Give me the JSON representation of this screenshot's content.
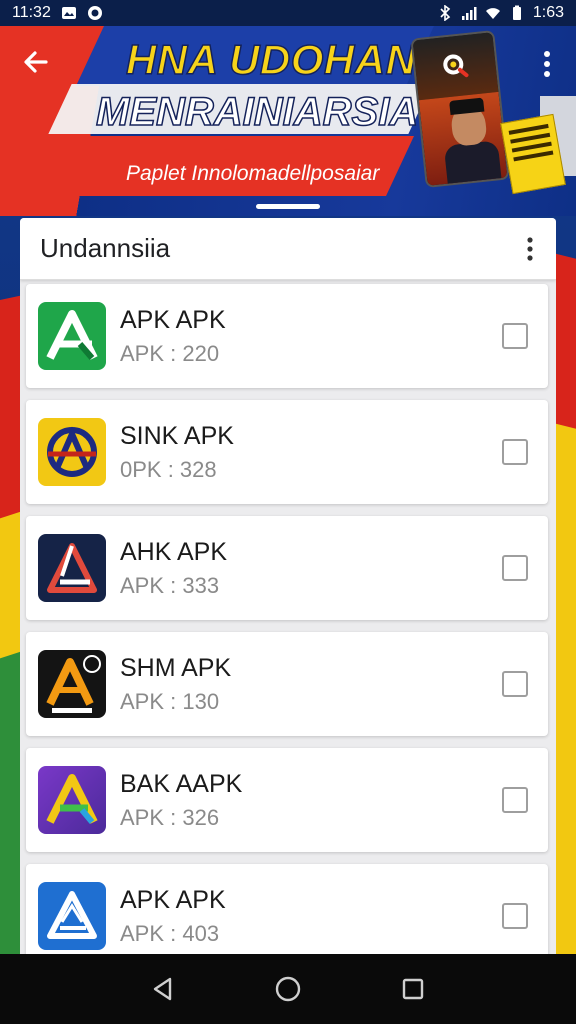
{
  "status_bar": {
    "time": "11:32",
    "right_time": "1:63",
    "icons": [
      "gallery-icon",
      "app-notification-icon",
      "bluetooth-icon",
      "signal-icon",
      "wifi-icon",
      "battery-icon"
    ]
  },
  "banner": {
    "title_line1": "HNA UDOHAN",
    "title_line2": "MENRAINIARSIA",
    "subtitle": "Paplet Innolomadellposaiar",
    "colors": {
      "red": "#e53224",
      "blue": "#0e2f86",
      "yellow": "#f7d31a"
    }
  },
  "sheet": {
    "title": "Undannsiia"
  },
  "apps": [
    {
      "name": "APK APK",
      "sub": "APK : 220",
      "icon": "green-a-logo-icon",
      "checked": false
    },
    {
      "name": "SINK APK",
      "sub": "0PK : 328",
      "icon": "yellow-compass-logo-icon",
      "checked": false
    },
    {
      "name": "AHK APK",
      "sub": "APK : 333",
      "icon": "red-triangle-logo-icon",
      "checked": false
    },
    {
      "name": "SHM APK",
      "sub": "APK : 130",
      "icon": "orange-a-logo-icon",
      "checked": false
    },
    {
      "name": "BAK AAPK",
      "sub": "APK : 326",
      "icon": "purple-green-a-logo-icon",
      "checked": false
    },
    {
      "name": "APK APK",
      "sub": "APK : 403",
      "icon": "blue-triangle-logo-icon",
      "checked": false
    }
  ],
  "nav": [
    "back-icon",
    "home-icon",
    "recents-icon"
  ]
}
